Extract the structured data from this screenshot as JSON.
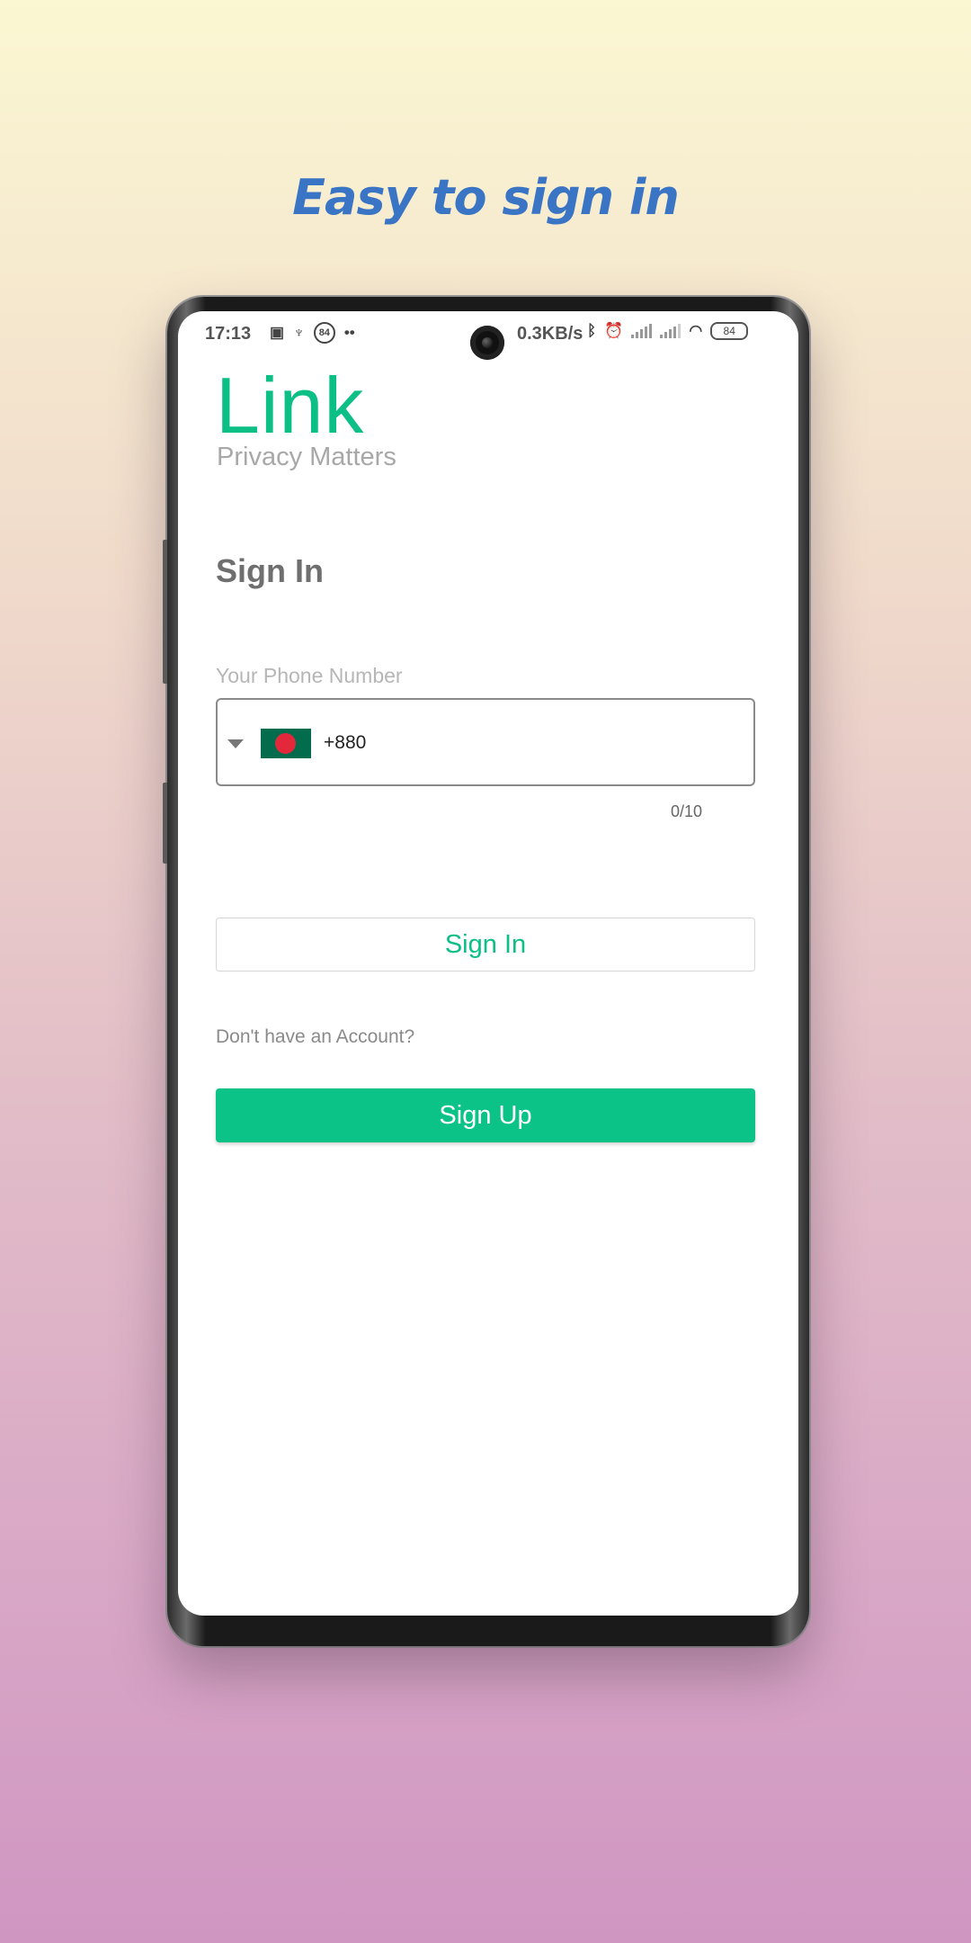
{
  "promo": {
    "title": "Easy to sign in"
  },
  "status_bar": {
    "time": "17:13",
    "notification_badge": "84",
    "more_dots": "••",
    "net_speed": "0.3KB/s",
    "battery_level": "84"
  },
  "app": {
    "logo_text": "Link",
    "tagline": "Privacy Matters"
  },
  "signin_form": {
    "heading": "Sign In",
    "phone_label": "Your Phone Number",
    "country_flag": "bangladesh-flag",
    "dial_code": "+880",
    "char_counter": "0/10",
    "signin_button_label": "Sign In",
    "no_account_text": "Don't have an Account?",
    "signup_button_label": "Sign Up"
  },
  "colors": {
    "accent": "#0bbf85",
    "promo_title": "#3a74c4"
  }
}
